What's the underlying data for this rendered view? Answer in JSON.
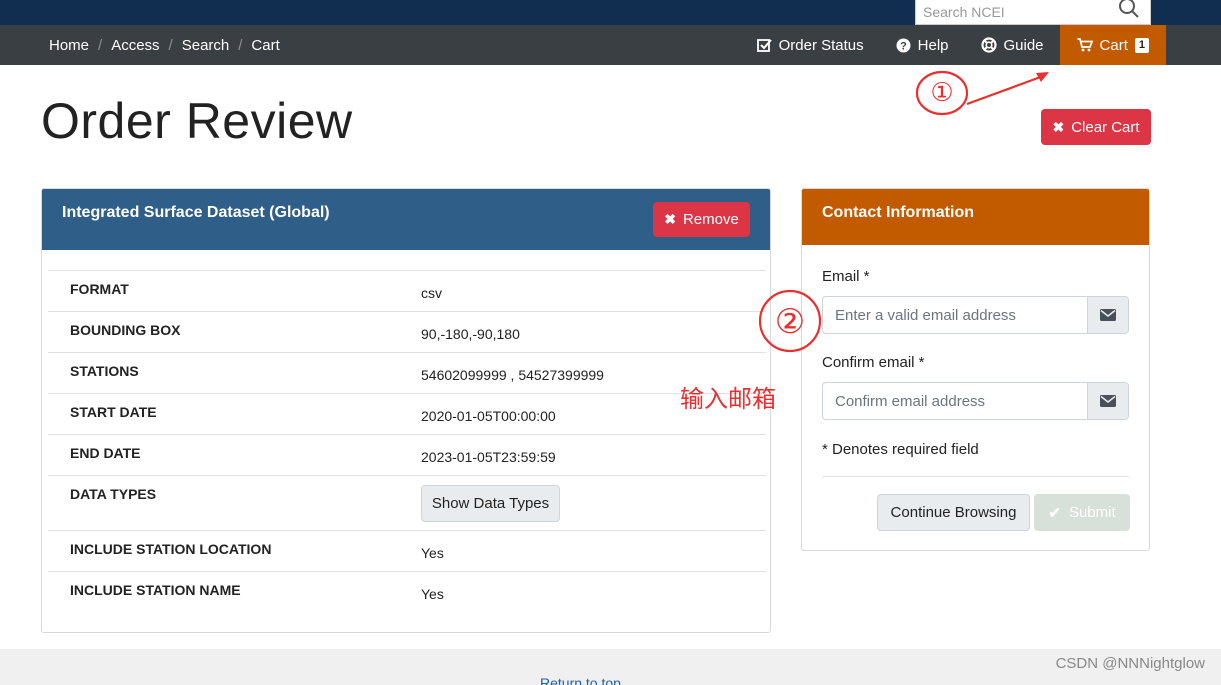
{
  "search": {
    "placeholder": "Search NCEI"
  },
  "breadcrumb": [
    "Home",
    "Access",
    "Search",
    "Cart"
  ],
  "nav": {
    "order_status": "Order Status",
    "help": "Help",
    "guide": "Guide",
    "cart": "Cart",
    "cart_count": "1"
  },
  "page": {
    "title": "Order Review",
    "clear_cart": "Clear Cart"
  },
  "dataset": {
    "title": "Integrated Surface Dataset (Global)",
    "remove": "Remove",
    "rows": [
      {
        "key": "FORMAT",
        "value": "csv"
      },
      {
        "key": "BOUNDING BOX",
        "value": "90,-180,-90,180"
      },
      {
        "key": "STATIONS",
        "value": "54602099999 , 54527399999"
      },
      {
        "key": "START DATE",
        "value": "2020-01-05T00:00:00"
      },
      {
        "key": "END DATE",
        "value": "2023-01-05T23:59:59"
      },
      {
        "key": "DATA TYPES",
        "button": "Show Data Types"
      },
      {
        "key": "INCLUDE STATION LOCATION",
        "value": "Yes"
      },
      {
        "key": "INCLUDE STATION NAME",
        "value": "Yes"
      }
    ]
  },
  "contact": {
    "title": "Contact Information",
    "email_label": "Email *",
    "email_placeholder": "Enter a valid email address",
    "confirm_label": "Confirm email *",
    "confirm_placeholder": "Confirm email address",
    "required_note": "* Denotes required field",
    "continue": "Continue Browsing",
    "submit": "Submit"
  },
  "annotations": {
    "marker1": "①",
    "marker2": "②",
    "note": "输入邮箱"
  },
  "footer": {
    "return_top": "Return to top"
  },
  "watermark": "CSDN @NNNightglow",
  "colors": {
    "topbar": "#112e51",
    "navbar": "#3a3f44",
    "cart": "#c25a00",
    "danger": "#dc3545",
    "panel_head": "#2f5e88",
    "annotation": "#e83030"
  }
}
